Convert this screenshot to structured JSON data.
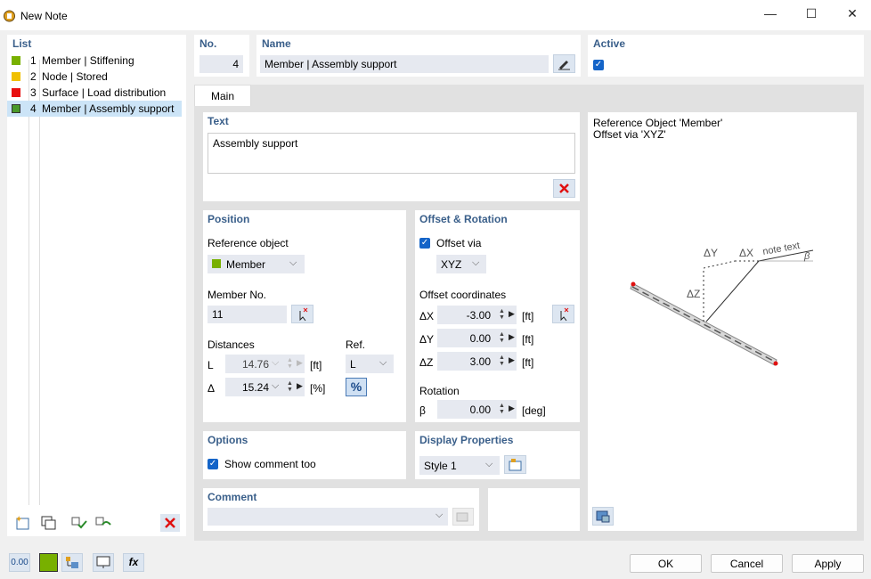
{
  "window": {
    "title": "New Note"
  },
  "list": {
    "header": "List",
    "items": [
      {
        "num": "1",
        "label": "Member | Stiffening",
        "color": "#78b000"
      },
      {
        "num": "2",
        "label": "Node | Stored",
        "color": "#f0c000"
      },
      {
        "num": "3",
        "label": "Surface | Load distribution",
        "color": "#e81010"
      },
      {
        "num": "4",
        "label": "Member | Assembly support",
        "color": "#4a9a2a",
        "selected": true
      }
    ]
  },
  "no": {
    "label": "No.",
    "value": "4"
  },
  "name": {
    "label": "Name",
    "value": "Member | Assembly support"
  },
  "active": {
    "label": "Active",
    "checked": true
  },
  "tabs": [
    {
      "label": "Main",
      "active": true
    }
  ],
  "text": {
    "label": "Text",
    "value": "Assembly support"
  },
  "position": {
    "label": "Position",
    "ref_object_label": "Reference object",
    "ref_object_value": "Member",
    "ref_object_color": "#78b000",
    "member_no_label": "Member No.",
    "member_no_value": "11",
    "distances_label": "Distances",
    "ref_label": "Ref.",
    "l_label": "L",
    "l_value": "14.76",
    "l_unit": "[ft]",
    "ref_value": "L",
    "delta_label": "Δ",
    "delta_value": "15.24",
    "delta_unit": "[%]",
    "percent": "%"
  },
  "offset": {
    "label": "Offset & Rotation",
    "offset_via_label": "Offset via",
    "offset_via_checked": true,
    "offset_via_value": "XYZ",
    "coords_label": "Offset coordinates",
    "dx_label": "ΔX",
    "dx_value": "-3.00",
    "dx_unit": "[ft]",
    "dy_label": "ΔY",
    "dy_value": "0.00",
    "dy_unit": "[ft]",
    "dz_label": "ΔZ",
    "dz_value": "3.00",
    "dz_unit": "[ft]",
    "rotation_label": "Rotation",
    "beta_label": "β",
    "beta_value": "0.00",
    "beta_unit": "[deg]"
  },
  "options": {
    "label": "Options",
    "show_comment_label": "Show comment too",
    "show_comment_checked": true
  },
  "display": {
    "label": "Display Properties",
    "style_value": "Style 1"
  },
  "comment": {
    "label": "Comment",
    "value": ""
  },
  "preview": {
    "line1": "Reference Object 'Member'",
    "line2": "Offset via 'XYZ'",
    "dy": "ΔY",
    "dx": "ΔX",
    "dz": "ΔZ",
    "note": "note text",
    "beta": "β"
  },
  "bottom": {
    "value_display": "0.00",
    "ok": "OK",
    "cancel": "Cancel",
    "apply": "Apply"
  }
}
